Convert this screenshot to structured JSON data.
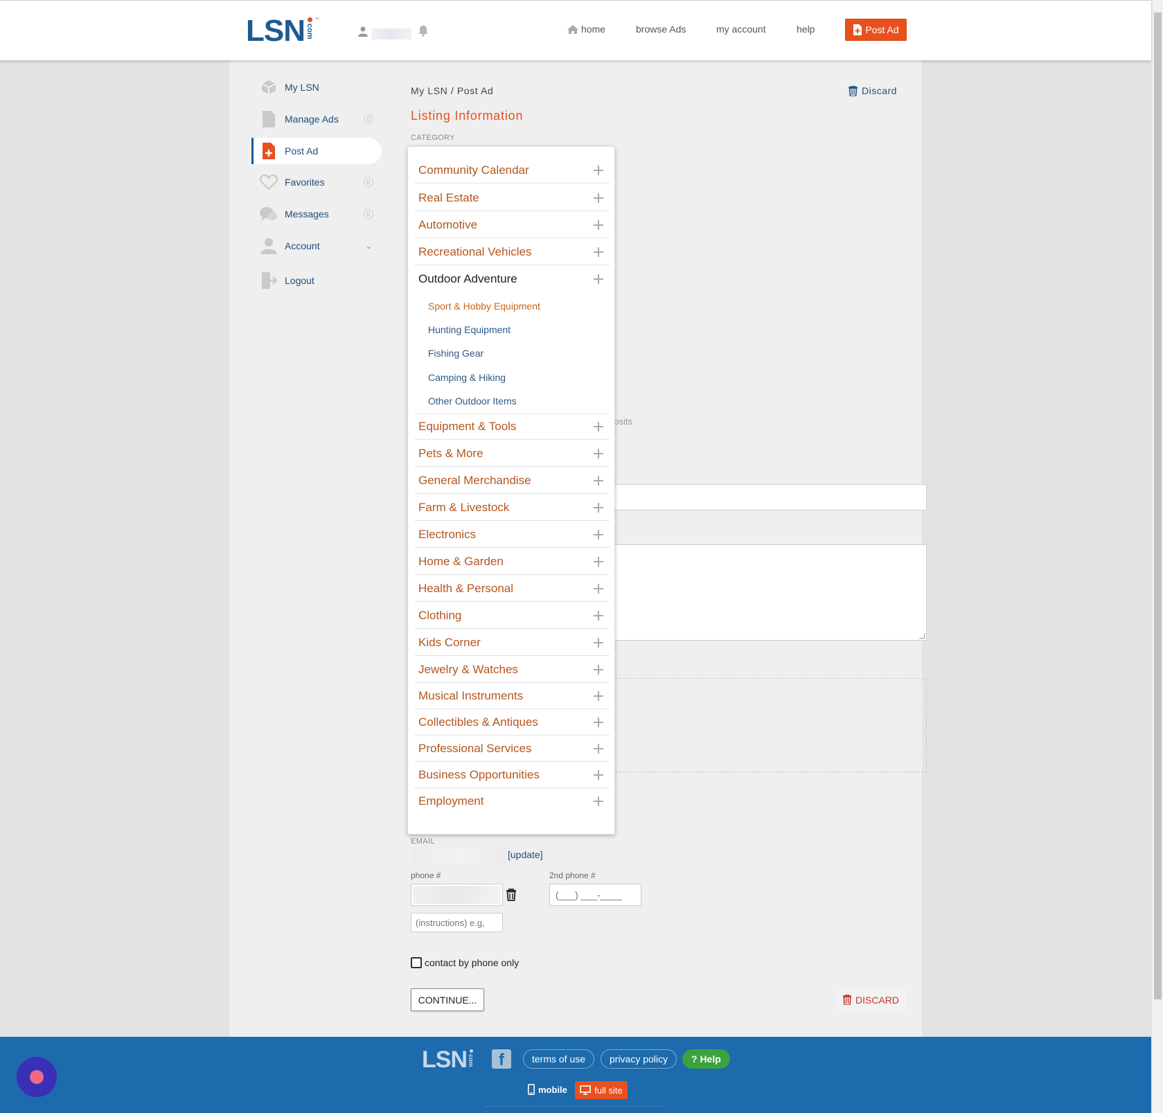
{
  "header": {
    "logo_text": "LSN",
    "logo_com": "com",
    "logo_tm": "™",
    "nav": {
      "home": "home",
      "browse": "browse Ads",
      "account": "my account",
      "help": "help",
      "post_ad": "Post Ad"
    }
  },
  "sidebar": {
    "items": [
      {
        "label": "My LSN",
        "badge": ""
      },
      {
        "label": "Manage Ads",
        "badge": "0"
      },
      {
        "label": "Post Ad",
        "badge": ""
      },
      {
        "label": "Favorites",
        "badge": "0"
      },
      {
        "label": "Messages",
        "badge": "0"
      },
      {
        "label": "Account",
        "badge": ""
      },
      {
        "label": "Logout",
        "badge": ""
      }
    ]
  },
  "main": {
    "breadcrumb": "My LSN / Post Ad",
    "discard_top": "Discard",
    "section_title": "Listing Information",
    "category_label": "CATEGORY",
    "hint_fragment": "posits",
    "email_label": "EMAIL",
    "update_link": "[update]",
    "phone_label": "phone #",
    "phone2_label": "2nd phone #",
    "phone2_placeholder": "(___) ___-____",
    "instructions_placeholder": "(instructions) e.g,",
    "contact_phone_only": "contact by phone only",
    "continue_label": "CONTINUE...",
    "discard_bottom": "DISCARD"
  },
  "category_dropdown": {
    "categories": [
      "Community Calendar",
      "Real Estate",
      "Automotive",
      "Recreational Vehicles",
      "Outdoor Adventure",
      "Equipment & Tools",
      "Pets & More",
      "General Merchandise",
      "Farm & Livestock",
      "Electronics",
      "Home & Garden",
      "Health & Personal",
      "Clothing",
      "Kids Corner",
      "Jewelry & Watches",
      "Musical Instruments",
      "Collectibles & Antiques",
      "Professional Services",
      "Business Opportunities",
      "Employment"
    ],
    "expanded_category": "Outdoor Adventure",
    "subcategories": [
      "Sport & Hobby Equipment",
      "Hunting Equipment",
      "Fishing Gear",
      "Camping & Hiking",
      "Other Outdoor Items"
    ]
  },
  "footer": {
    "logo_text": "LSN",
    "logo_com": "com",
    "facebook_glyph": "f",
    "terms": "terms of use",
    "privacy": "privacy policy",
    "help": "? Help",
    "mobile": "mobile",
    "full_site": "full site"
  },
  "colors": {
    "brand_blue": "#1d5b8f",
    "accent_orange": "#e8501d",
    "footer_blue": "#1d6aac",
    "help_green": "#3ba23f",
    "discard_red": "#c8342b"
  }
}
